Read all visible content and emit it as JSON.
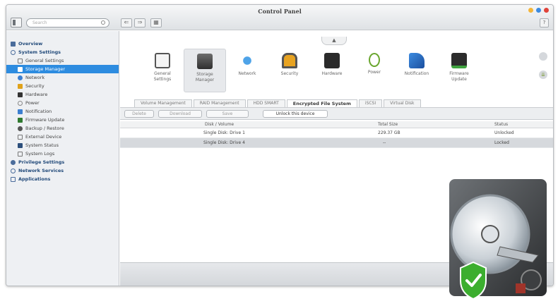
{
  "app": {
    "title": "Control Panel",
    "search_placeholder": "Search"
  },
  "colors": {
    "accent": "#2d8ce0",
    "window_close": "#e0433a",
    "window_min": "#f4b63a",
    "window_max": "#3d8be0",
    "shield_green": "#3cae2f"
  },
  "toolbar_top": {
    "back": "⇐",
    "forward": "⇒",
    "grid": "▦",
    "help": "?"
  },
  "sidebar": {
    "overview": "Overview",
    "system_settings": "System Settings",
    "items": [
      {
        "label": "General Settings",
        "icon": "general-settings-icon"
      },
      {
        "label": "Storage Manager",
        "icon": "storage-manager-icon"
      },
      {
        "label": "Network",
        "icon": "network-icon"
      },
      {
        "label": "Security",
        "icon": "security-icon"
      },
      {
        "label": "Hardware",
        "icon": "hardware-icon"
      },
      {
        "label": "Power",
        "icon": "power-icon"
      },
      {
        "label": "Notification",
        "icon": "notification-icon"
      },
      {
        "label": "Firmware Update",
        "icon": "firmware-update-icon"
      },
      {
        "label": "Backup / Restore",
        "icon": "backup-restore-icon"
      },
      {
        "label": "External Device",
        "icon": "external-device-icon"
      },
      {
        "label": "System Status",
        "icon": "system-status-icon"
      },
      {
        "label": "System Logs",
        "icon": "system-logs-icon"
      }
    ],
    "privilege_settings": "Privilege Settings",
    "network_services": "Network Services",
    "applications": "Applications"
  },
  "tools": [
    {
      "label1": "General",
      "label2": "Settings"
    },
    {
      "label1": "Storage",
      "label2": "Manager"
    },
    {
      "label1": "Network",
      "label2": ""
    },
    {
      "label1": "Security",
      "label2": ""
    },
    {
      "label1": "Hardware",
      "label2": ""
    },
    {
      "label1": "Power",
      "label2": ""
    },
    {
      "label1": "Notification",
      "label2": ""
    },
    {
      "label1": "Firmware",
      "label2": "Update"
    }
  ],
  "tabs": [
    "Volume Management",
    "RAID Management",
    "HDD SMART",
    "Encrypted File System",
    "iSCSI",
    "Virtual Disk"
  ],
  "actions": {
    "delete": "Delete",
    "download": "Download",
    "save": "Save",
    "unlock": "Unlock this device"
  },
  "grid": {
    "headers": {
      "disk": "Disk / Volume",
      "size": "Total Size",
      "status": "Status"
    },
    "rows": [
      {
        "disk": "Single Disk: Drive 1",
        "size": "229.37 GB",
        "status": "Unlocked"
      },
      {
        "disk": "Single Disk: Drive 4",
        "size": "--",
        "status": "Locked"
      }
    ]
  }
}
